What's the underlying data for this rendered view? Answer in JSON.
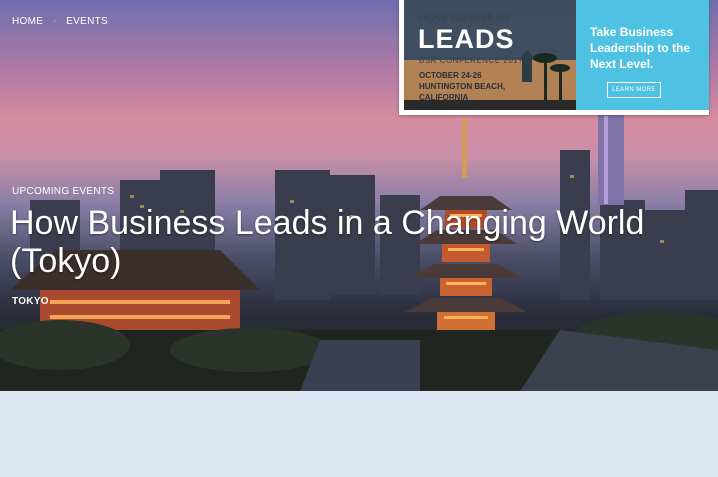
{
  "breadcrumb": {
    "items": [
      "HOME",
      "EVENTS"
    ]
  },
  "hero": {
    "eyebrow": "UPCOMING EVENTS",
    "title": "How Business Leads in a Changing World (Tokyo)",
    "location": "TOKYO"
  },
  "ad": {
    "small": "HOW BUSINESS",
    "big": "LEADS",
    "sub": "BSR CONFERENCE 2017",
    "date_line1": "OCTOBER 24-26",
    "date_line2": "HUNTINGTON BEACH,",
    "date_line3": "CALIFORNIA",
    "tagline": "Take Business Leadership to the Next Level.",
    "button": "LEARN MORE"
  },
  "colors": {
    "ad_blue": "#4fc2e3",
    "page_bg": "#dde8f4"
  }
}
